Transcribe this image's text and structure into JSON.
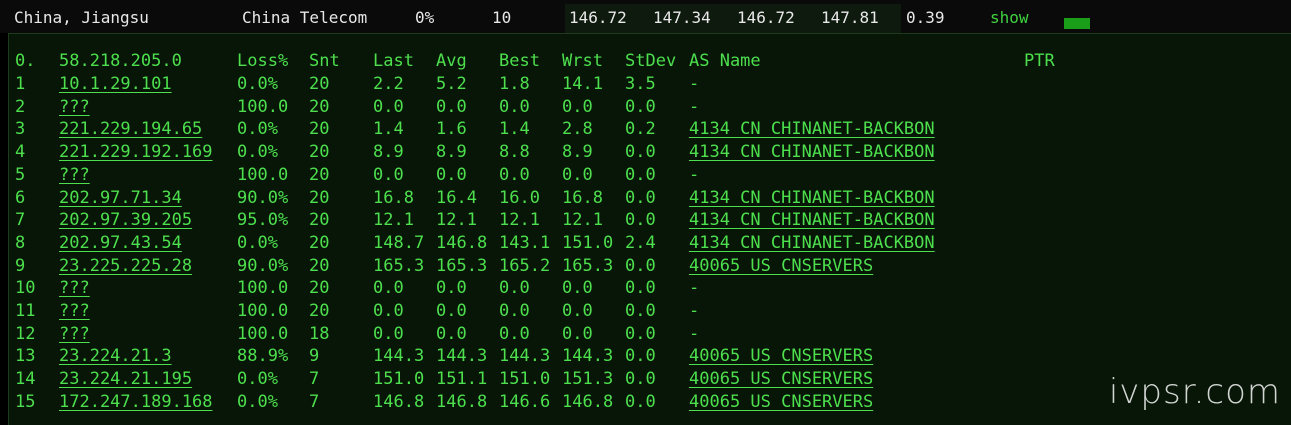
{
  "summary": {
    "location": "China, Jiangsu",
    "isp": "China Telecom",
    "loss": "0%",
    "sent": "10",
    "last": "146.72",
    "avg": "147.34",
    "best": "146.72",
    "worst": "147.81",
    "stdev": "0.39",
    "show_label": "show"
  },
  "table": {
    "headers": {
      "hop": "0.",
      "host": "58.218.205.0",
      "loss": "Loss%",
      "snt": "Snt",
      "last": "Last",
      "avg": "Avg",
      "best": "Best",
      "wrst": "Wrst",
      "stdev": "StDev",
      "as_name": "AS Name",
      "ptr": "PTR"
    },
    "rows": [
      {
        "hop": "1",
        "host": "10.1.29.101",
        "loss": "0.0%",
        "snt": "20",
        "last": "2.2",
        "avg": "5.2",
        "best": "1.8",
        "wrst": "14.1",
        "stdev": "3.5",
        "as_name": "-"
      },
      {
        "hop": "2",
        "host": "???",
        "loss": "100.0",
        "snt": "20",
        "last": "0.0",
        "avg": "0.0",
        "best": "0.0",
        "wrst": "0.0",
        "stdev": "0.0",
        "as_name": "-"
      },
      {
        "hop": "3",
        "host": "221.229.194.65",
        "loss": "0.0%",
        "snt": "20",
        "last": "1.4",
        "avg": "1.6",
        "best": "1.4",
        "wrst": "2.8",
        "stdev": "0.2",
        "as_name": "4134  CN CHINANET-BACKBON"
      },
      {
        "hop": "4",
        "host": "221.229.192.169",
        "loss": "0.0%",
        "snt": "20",
        "last": "8.9",
        "avg": "8.9",
        "best": "8.8",
        "wrst": "8.9",
        "stdev": "0.0",
        "as_name": "4134  CN CHINANET-BACKBON"
      },
      {
        "hop": "5",
        "host": "???",
        "loss": "100.0",
        "snt": "20",
        "last": "0.0",
        "avg": "0.0",
        "best": "0.0",
        "wrst": "0.0",
        "stdev": "0.0",
        "as_name": "-"
      },
      {
        "hop": "6",
        "host": "202.97.71.34",
        "loss": "90.0%",
        "snt": "20",
        "last": "16.8",
        "avg": "16.4",
        "best": "16.0",
        "wrst": "16.8",
        "stdev": "0.0",
        "as_name": "4134  CN CHINANET-BACKBON"
      },
      {
        "hop": "7",
        "host": "202.97.39.205",
        "loss": "95.0%",
        "snt": "20",
        "last": "12.1",
        "avg": "12.1",
        "best": "12.1",
        "wrst": "12.1",
        "stdev": "0.0",
        "as_name": "4134  CN CHINANET-BACKBON"
      },
      {
        "hop": "8",
        "host": "202.97.43.54",
        "loss": "0.0%",
        "snt": "20",
        "last": "148.7",
        "avg": "146.8",
        "best": "143.1",
        "wrst": "151.0",
        "stdev": "2.4",
        "as_name": "4134  CN CHINANET-BACKBON"
      },
      {
        "hop": "9",
        "host": "23.225.225.28",
        "loss": "90.0%",
        "snt": "20",
        "last": "165.3",
        "avg": "165.3",
        "best": "165.2",
        "wrst": "165.3",
        "stdev": "0.0",
        "as_name": "40065 US CNSERVERS"
      },
      {
        "hop": "10",
        "host": "???",
        "loss": "100.0",
        "snt": "20",
        "last": "0.0",
        "avg": "0.0",
        "best": "0.0",
        "wrst": "0.0",
        "stdev": "0.0",
        "as_name": "-"
      },
      {
        "hop": "11",
        "host": "???",
        "loss": "100.0",
        "snt": "20",
        "last": "0.0",
        "avg": "0.0",
        "best": "0.0",
        "wrst": "0.0",
        "stdev": "0.0",
        "as_name": "-"
      },
      {
        "hop": "12",
        "host": "???",
        "loss": "100.0",
        "snt": "18",
        "last": "0.0",
        "avg": "0.0",
        "best": "0.0",
        "wrst": "0.0",
        "stdev": "0.0",
        "as_name": "-"
      },
      {
        "hop": "13",
        "host": "23.224.21.3",
        "loss": "88.9%",
        "snt": "9",
        "last": "144.3",
        "avg": "144.3",
        "best": "144.3",
        "wrst": "144.3",
        "stdev": "0.0",
        "as_name": "40065 US CNSERVERS"
      },
      {
        "hop": "14",
        "host": "23.224.21.195",
        "loss": "0.0%",
        "snt": "7",
        "last": "151.0",
        "avg": "151.1",
        "best": "151.0",
        "wrst": "151.3",
        "stdev": "0.0",
        "as_name": "40065 US CNSERVERS"
      },
      {
        "hop": "15",
        "host": "172.247.189.168",
        "loss": "0.0%",
        "snt": "7",
        "last": "146.8",
        "avg": "146.8",
        "best": "146.6",
        "wrst": "146.8",
        "stdev": "0.0",
        "as_name": "40065 US CNSERVERS"
      }
    ]
  },
  "watermark": "ivpsr.com"
}
